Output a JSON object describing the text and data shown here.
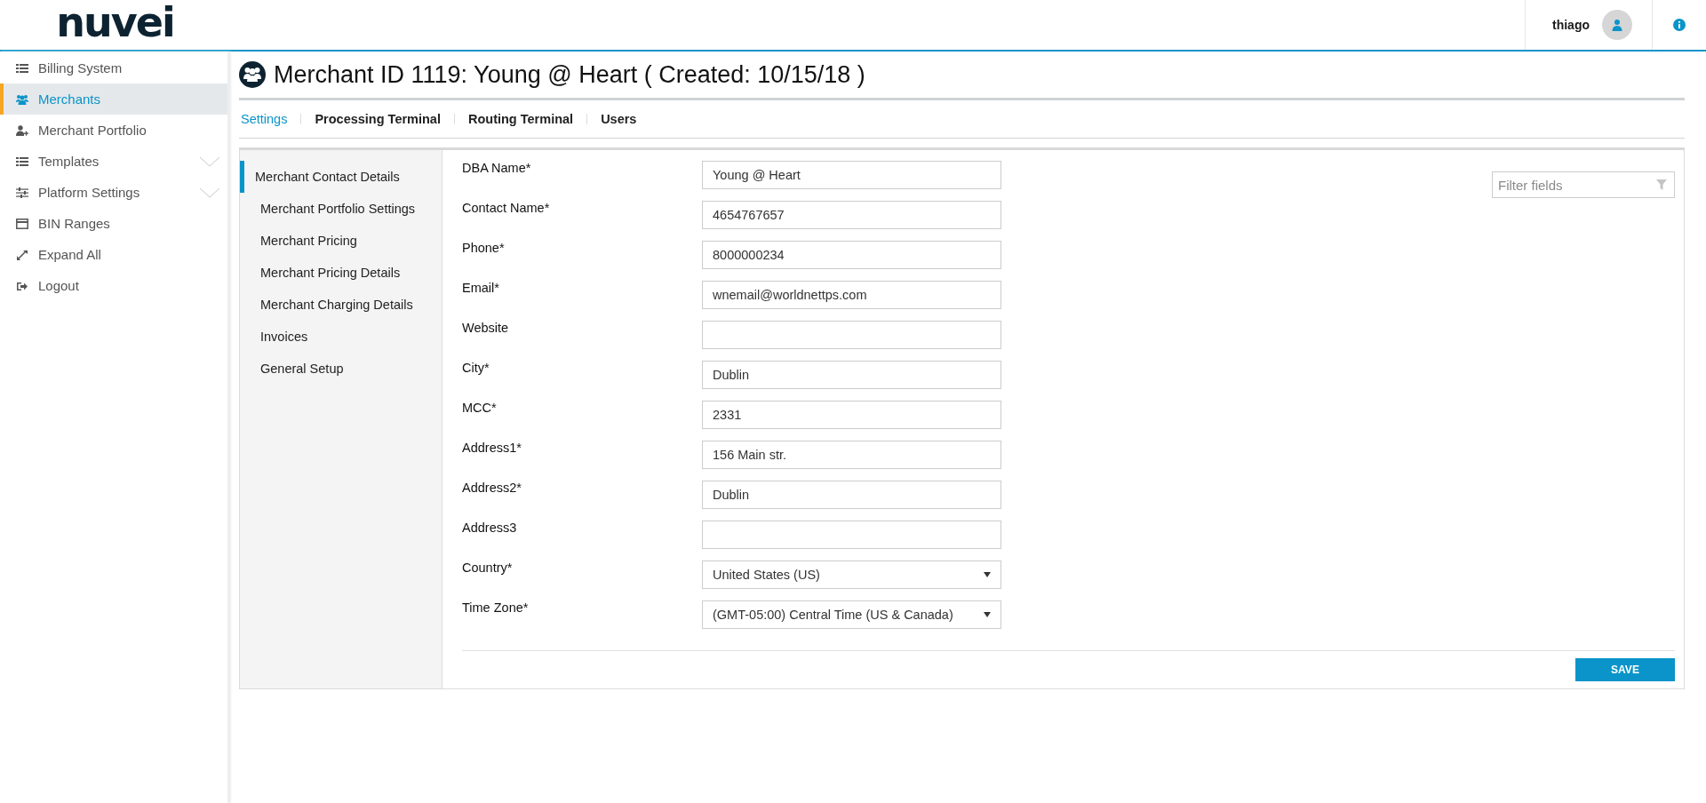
{
  "header": {
    "logo": "nuvei",
    "user": "thiago"
  },
  "sidebar": {
    "items": [
      {
        "label": "Billing System",
        "kind": "list",
        "selected": false,
        "expandable": false
      },
      {
        "label": "Merchants",
        "kind": "users",
        "selected": true,
        "expandable": false
      },
      {
        "label": "Merchant Portfolio",
        "kind": "adduser",
        "selected": false,
        "expandable": false
      },
      {
        "label": "Templates",
        "kind": "list",
        "selected": false,
        "expandable": true
      },
      {
        "label": "Platform Settings",
        "kind": "sliders",
        "selected": false,
        "expandable": true
      },
      {
        "label": "BIN Ranges",
        "kind": "card",
        "selected": false,
        "expandable": false
      },
      {
        "label": "Expand All",
        "kind": "expand",
        "selected": false,
        "expandable": false
      },
      {
        "label": "Logout",
        "kind": "logout",
        "selected": false,
        "expandable": false
      }
    ]
  },
  "page": {
    "title": "Merchant ID 1119: Young @ Heart ( Created: 10/15/18 )",
    "tabs": [
      {
        "label": "Settings",
        "selected": true
      },
      {
        "label": "Processing Terminal",
        "selected": false
      },
      {
        "label": "Routing Terminal",
        "selected": false
      },
      {
        "label": "Users",
        "selected": false
      }
    ]
  },
  "sections": [
    {
      "label": "Merchant Contact Details",
      "selected": true
    },
    {
      "label": "Merchant Portfolio Settings",
      "selected": false
    },
    {
      "label": "Merchant Pricing",
      "selected": false
    },
    {
      "label": "Merchant Pricing Details",
      "selected": false
    },
    {
      "label": "Merchant Charging Details",
      "selected": false
    },
    {
      "label": "Invoices",
      "selected": false
    },
    {
      "label": "General Setup",
      "selected": false
    }
  ],
  "form": {
    "fields": [
      {
        "kind": "text",
        "label": "DBA Name*",
        "value": "Young @ Heart"
      },
      {
        "kind": "text",
        "label": "Contact Name*",
        "value": "4654767657"
      },
      {
        "kind": "text",
        "label": "Phone*",
        "value": "8000000234"
      },
      {
        "kind": "text",
        "label": "Email*",
        "value": "wnemail@worldnettps.com"
      },
      {
        "kind": "text",
        "label": "Website"
      },
      {
        "kind": "text",
        "label": "City*",
        "value": "Dublin"
      },
      {
        "kind": "text",
        "label": "MCC*",
        "value": "2331"
      },
      {
        "kind": "text",
        "label": "Address1*",
        "value": "156 Main str."
      },
      {
        "kind": "text",
        "label": "Address2*",
        "value": "Dublin"
      },
      {
        "kind": "text",
        "label": "Address3"
      },
      {
        "kind": "select",
        "label": "Country*",
        "value": "United States (US)"
      },
      {
        "kind": "select",
        "label": "Time Zone*",
        "value": "(GMT-05:00) Central Time (US & Canada)"
      }
    ],
    "filter": {
      "placeholder": "Filter fields"
    },
    "save_button": "SAVE"
  }
}
